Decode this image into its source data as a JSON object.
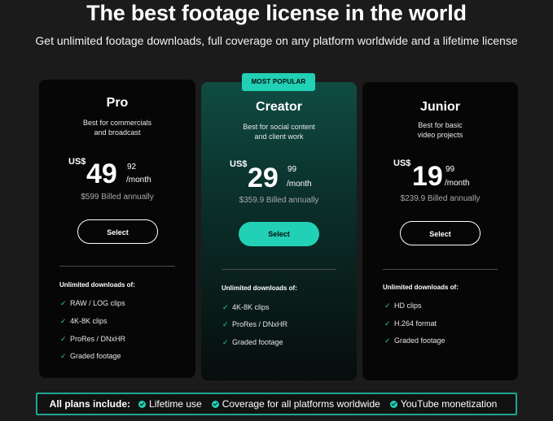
{
  "header": {
    "title": "The best footage license in the world",
    "subtitle": "Get unlimited footage downloads, full coverage on any platform worldwide and a lifetime license"
  },
  "colors": {
    "accent": "#22d0b5",
    "background": "#1b1b1b",
    "card": "#060606"
  },
  "plans": [
    {
      "name": "Pro",
      "description_line1": "Best for commercials",
      "description_line2": "and broadcast",
      "currency": "US$",
      "price": "49",
      "cents": "92",
      "period": "/month",
      "billed": "$599 Billed annually",
      "button_label": "Select",
      "features_heading": "Unlimited downloads of:",
      "features": [
        "RAW / LOG clips",
        "4K-8K clips",
        "ProRes / DNxHR",
        "Graded footage"
      ]
    },
    {
      "name": "Creator",
      "badge": "MOST POPULAR",
      "description_line1": "Best for social content",
      "description_line2": "and client work",
      "currency": "US$",
      "price": "29",
      "cents": "99",
      "period": "/month",
      "billed": "$359.9 Billed annually",
      "button_label": "Select",
      "features_heading": "Unlimited downloads of:",
      "features": [
        "4K-8K clips",
        "ProRes / DNxHR",
        "Graded footage"
      ]
    },
    {
      "name": "Junior",
      "description_line1": "Best for basic",
      "description_line2": "video projects",
      "currency": "US$",
      "price": "19",
      "cents": "99",
      "period": "/month",
      "billed": "$239.9 Billed annually",
      "button_label": "Select",
      "features_heading": "Unlimited downloads of:",
      "features": [
        "HD clips",
        "H.264 format",
        "Graded footage"
      ]
    }
  ],
  "footer": {
    "lead": "All plans include:",
    "items": [
      "Lifetime use",
      "Coverage for all platforms worldwide",
      "YouTube monetization"
    ]
  }
}
